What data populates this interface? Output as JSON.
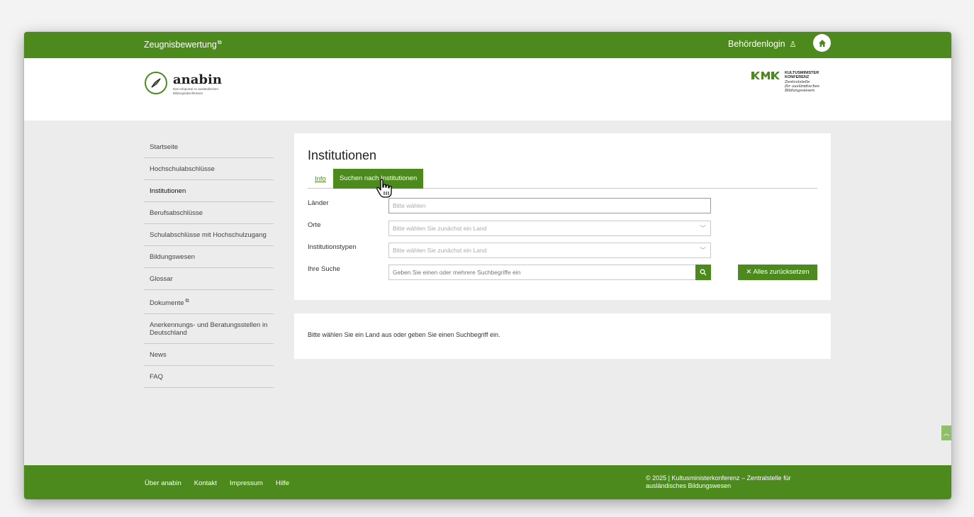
{
  "topbar": {
    "left_link": "Zeugnisbewertung",
    "left_link_icon": "external-link-icon",
    "login_label": "Behördenlogin",
    "login_icon": "person-icon",
    "home_icon": "home-icon"
  },
  "brand": {
    "name": "anabin",
    "tagline": "Das Infoportal zu ausländischen Bildungsabschlüssen",
    "kmk_lines": [
      "KULTUSMINISTER",
      "KONFERENZ",
      "Zentralstelle",
      "für ausländisches",
      "Bildungswesen"
    ]
  },
  "sidebar": {
    "items": [
      {
        "label": "Startseite"
      },
      {
        "label": "Hochschulabschlüsse"
      },
      {
        "label": "Institutionen",
        "active": true
      },
      {
        "label": "Berufsabschlüsse"
      },
      {
        "label": "Schulabschlüsse mit Hochschulzugang"
      },
      {
        "label": "Bildungswesen"
      },
      {
        "label": "Glossar"
      },
      {
        "label": "Dokumente",
        "external": true
      },
      {
        "label": "Anerkennungs- und Beratungsstellen in Deutschland"
      },
      {
        "label": "News"
      },
      {
        "label": "FAQ"
      }
    ]
  },
  "main": {
    "title": "Institutionen",
    "tabs": [
      {
        "label": "Info"
      },
      {
        "label": "Suchen nach Institutionen",
        "active": true
      }
    ],
    "form": {
      "countries_label": "Länder",
      "countries_placeholder": "Bitte wählen",
      "cities_label": "Orte",
      "cities_placeholder": "Bitte wählen Sie zunächst ein Land",
      "types_label": "Institutionstypen",
      "types_placeholder": "Bitte wählen Sie zunächst ein Land",
      "search_label": "Ihre Suche",
      "search_placeholder": "Geben Sie einen oder mehrere Suchbegriffe ein",
      "reset_label": "Alles zurücksetzen"
    },
    "result_message": "Bitte wählen Sie ein Land aus oder geben Sie einen Suchbegriff ein."
  },
  "footer": {
    "links": [
      "Über anabin",
      "Kontakt",
      "Impressum",
      "Hilfe"
    ],
    "copyright": "© 2025 | Kultusministerkonferenz – Zentralstelle für ausländisches Bildungswesen"
  },
  "colors": {
    "brand_green": "#4c8a1e",
    "background": "#ececec"
  }
}
